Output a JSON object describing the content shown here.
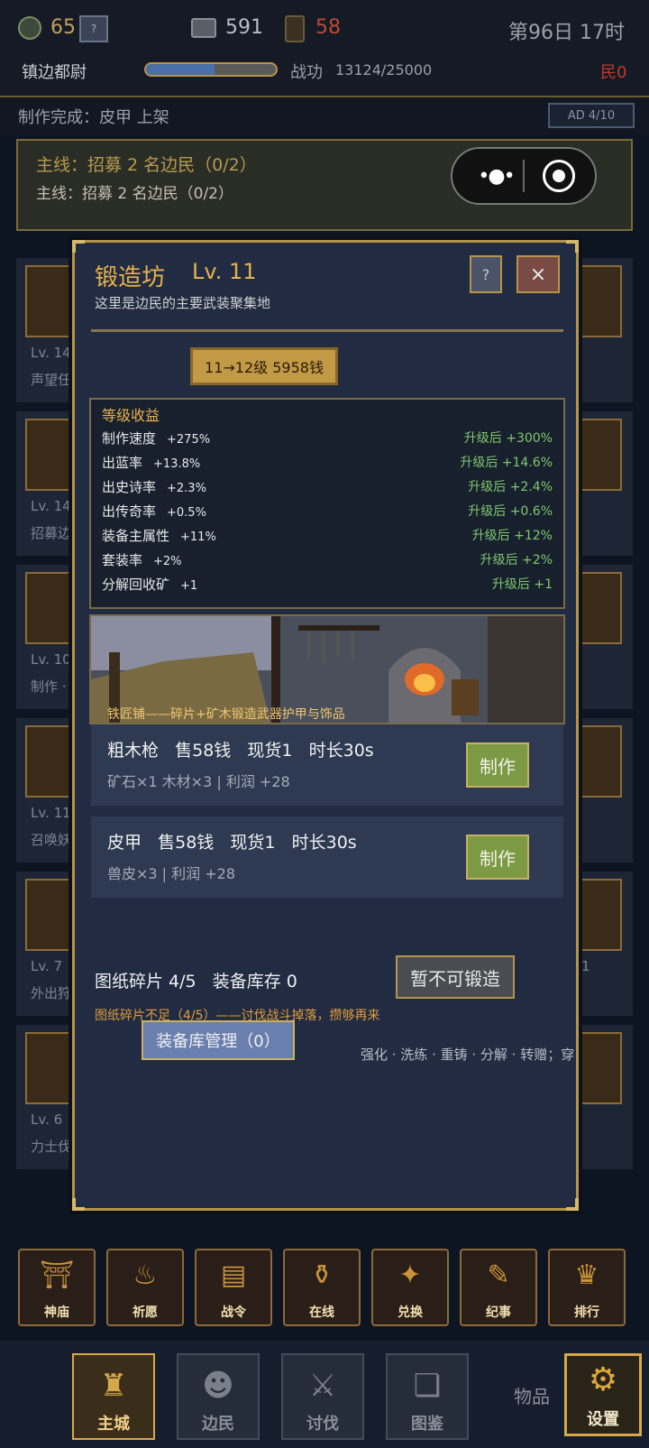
{
  "status": {
    "coins": "65",
    "silver": "591",
    "keys": "58",
    "day_time": "第96日 17时",
    "rank": "镇边都尉",
    "merit_label": "战功",
    "merit_value": "13124/25000",
    "merit_progress": 0.5248,
    "people": "民0",
    "small_icon": "?"
  },
  "notice": {
    "text": "制作完成：皮甲 上架",
    "ad": "AD 4/10"
  },
  "quest": {
    "main": "主线：招募 2 名边民（0/2）",
    "sub": "主线：招募 2 名边民（0/2）"
  },
  "bg_cards": [
    {
      "lv": "Lv. 14",
      "desc": "声望任"
    },
    {
      "lv": "Lv. 14",
      "desc": "招募边"
    },
    {
      "lv": "Lv. 10",
      "desc": "制作 ·"
    },
    {
      "lv": "Lv. 11",
      "desc": "召唤妖"
    },
    {
      "lv": "Lv. 7",
      "desc": "外出狩",
      "right": "/1"
    },
    {
      "lv": "Lv. 6",
      "desc": "力士伐"
    }
  ],
  "modal": {
    "title": "锻造坊",
    "level": "Lv. 11",
    "subtitle": "这里是边民的主要武装聚集地",
    "help_label": "?",
    "close_label": "×",
    "upgrade_label": "11→12级 5958钱",
    "benefits_title": "等级收益",
    "benefits": [
      {
        "name": "制作速度",
        "value": "+275%",
        "after": "升级后 +300%"
      },
      {
        "name": "出蓝率",
        "value": "+13.8%",
        "after": "升级后 +14.6%"
      },
      {
        "name": "出史诗率",
        "value": "+2.3%",
        "after": "升级后 +2.4%"
      },
      {
        "name": "出传奇率",
        "value": "+0.5%",
        "after": "升级后 +0.6%"
      },
      {
        "name": "装备主属性",
        "value": "+11%",
        "after": "升级后 +12%"
      },
      {
        "name": "套装率",
        "value": "+2%",
        "after": "升级后 +2%"
      },
      {
        "name": "分解回收矿",
        "value": "+1",
        "after": "升级后 +1"
      }
    ],
    "scene_caption": "铁匠铺——碎片+矿木锻造武器护甲与饰品",
    "recipes": [
      {
        "title": "粗木枪   售58钱   现货1   时长30s",
        "sub": "矿石×1 木材×3 | 利润 +28",
        "button": "制作"
      },
      {
        "title": "皮甲   售58钱   现货1   时长30s",
        "sub": "兽皮×3 | 利润 +28",
        "button": "制作"
      }
    ],
    "blueprint": "图纸碎片 4/5   装备库存 0",
    "no_forge": "暂不可锻造",
    "warning": "图纸碎片不足（4/5）——讨伐战斗掉落，攒够再来",
    "armory": "装备库管理（0）",
    "ops": "强化 · 洗练 · 重铸 · 分解 · 转赠；穿"
  },
  "icon_row": [
    {
      "label": "神庙",
      "icon": "temple-icon",
      "glyph": "⛩"
    },
    {
      "label": "祈愿",
      "icon": "cauldron-icon",
      "glyph": "♨"
    },
    {
      "label": "战令",
      "icon": "scroll-icon",
      "glyph": "▤"
    },
    {
      "label": "在线",
      "icon": "chest-icon",
      "glyph": "⚱"
    },
    {
      "label": "兑换",
      "icon": "gift-icon",
      "glyph": "✦"
    },
    {
      "label": "纪事",
      "icon": "book-icon",
      "glyph": "✎"
    },
    {
      "label": "排行",
      "icon": "laurel-icon",
      "glyph": "♛"
    }
  ],
  "nav": [
    {
      "label": "主城",
      "icon": "castle-icon",
      "glyph": "♜",
      "active": true
    },
    {
      "label": "边民",
      "icon": "villager-icon",
      "glyph": "☻",
      "active": false
    },
    {
      "label": "讨伐",
      "icon": "swords-icon",
      "glyph": "⚔",
      "active": false
    },
    {
      "label": "图鉴",
      "icon": "codex-icon",
      "glyph": "❏",
      "active": false
    }
  ],
  "items_label": "物品",
  "settings_label": "设置",
  "colors": {
    "gold": "#e6b04e",
    "green": "#7ec86e",
    "warning": "#e09a3a",
    "danger": "#c0392b"
  }
}
